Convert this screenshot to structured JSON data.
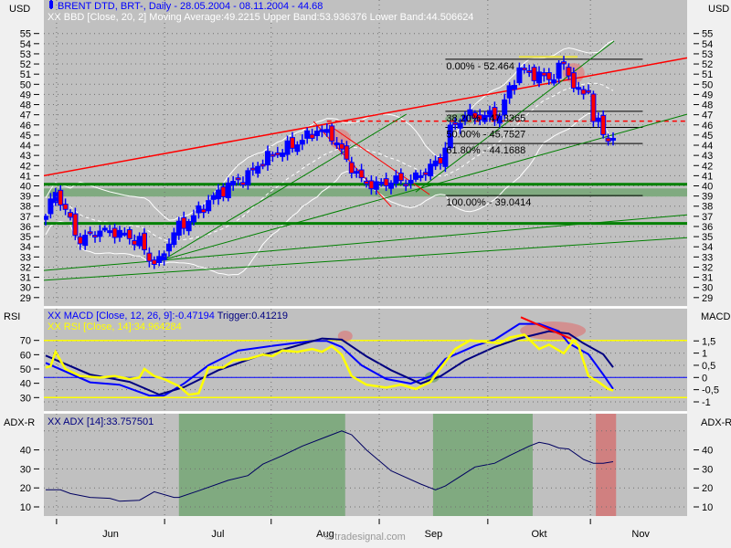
{
  "panels": {
    "main": {
      "axis_label_left": "USD",
      "axis_label_right": "USD",
      "title": "BRENT DTD, BRT-, Daily - 28.05.2004 - 08.11.2004 - 44.68",
      "bands_marker": "XX",
      "bands_legend": "BBD [Close, 20, 2] Moving Average:49.2215 Upper Band:53.936376 Lower Band:44.506624"
    },
    "rsi": {
      "axis_label_left": "RSI",
      "axis_label_right": "MACD",
      "macd_marker": "XX",
      "macd_legend": "MACD [Close, 12, 26, 9]:-0.47194",
      "trigger_legend": "Trigger:0.41219",
      "rsi_marker": "XX",
      "rsi_legend": "RSI [Close, 14]:34.964284"
    },
    "adx": {
      "axis_label_left": "ADX-R",
      "axis_label_right": "ADX-R",
      "marker": "XX",
      "legend": "ADX [14]:33.757501"
    }
  },
  "footer": "© tradesignal.com",
  "colors": {
    "plot_bg": "#c0c0c0",
    "page_bg": "#f0f0f0",
    "up_candle": "#0000ff",
    "down_candle": "#ff0000",
    "macd": "#0000ff",
    "trigger": "#000080",
    "rsi": "#ffff00",
    "adx": "#000060",
    "green_zone": "#80aa80",
    "red_zone": "#d08080",
    "support": "#008000",
    "trend_red": "#ff0000"
  },
  "chart_data": [
    {
      "type": "candlestick",
      "title": "BRENT DTD, BRT-, Daily - 28.05.2004 - 08.11.2004 - 44.68",
      "ylabel": "USD",
      "ylim": [
        29,
        55
      ],
      "yticks": [
        29,
        30,
        31,
        32,
        33,
        34,
        35,
        36,
        37,
        38,
        39,
        40,
        41,
        42,
        43,
        44,
        45,
        46,
        47,
        48,
        49,
        50,
        51,
        52,
        53,
        54,
        55
      ],
      "x_unit": "trading day since 28.05.2004",
      "x_range": [
        0,
        115
      ],
      "xticks": [
        {
          "label": "Jun",
          "day": 2.2
        },
        {
          "label": "Jul",
          "day": 24.1
        },
        {
          "label": "Aug",
          "day": 45.7
        },
        {
          "label": "Sep",
          "day": 67.6
        },
        {
          "label": "Okt",
          "day": 89.6
        },
        {
          "label": "Nov",
          "day": 110.4
        }
      ],
      "close_path": [
        [
          0,
          37.0
        ],
        [
          2,
          39.5
        ],
        [
          5,
          36.5
        ],
        [
          7,
          34.5
        ],
        [
          10,
          35.5
        ],
        [
          14,
          35.5
        ],
        [
          19,
          34.5
        ],
        [
          21,
          32.8
        ],
        [
          23,
          32.4
        ],
        [
          24,
          33.5
        ],
        [
          26,
          35.5
        ],
        [
          30,
          37.0
        ],
        [
          33,
          38.5
        ],
        [
          37,
          40.0
        ],
        [
          41,
          41.0
        ],
        [
          44,
          42.5
        ],
        [
          48,
          43.5
        ],
        [
          52,
          44.5
        ],
        [
          55,
          45.5
        ],
        [
          58,
          45.0
        ],
        [
          61,
          42.5
        ],
        [
          64,
          40.5
        ],
        [
          67,
          40.0
        ],
        [
          70,
          40.5
        ],
        [
          74,
          40.5
        ],
        [
          77,
          41.5
        ],
        [
          80,
          42.5
        ],
        [
          82,
          45.5
        ],
        [
          85,
          47.0
        ],
        [
          88,
          46.8
        ],
        [
          92,
          47.0
        ],
        [
          94,
          49.5
        ],
        [
          96,
          51.5
        ],
        [
          99,
          51.0
        ],
        [
          102,
          50.5
        ],
        [
          105,
          52.0
        ],
        [
          106,
          51.0
        ],
        [
          108,
          49.0
        ],
        [
          110,
          49.5
        ],
        [
          111,
          46.5
        ],
        [
          113,
          45.5
        ],
        [
          114,
          44.5
        ],
        [
          115,
          44.68
        ]
      ],
      "bollinger": {
        "period": 20,
        "stddev": 2,
        "moving_average": 49.2215,
        "upper": 53.936376,
        "lower": 44.506624
      },
      "fibonacci": {
        "from_day": 81,
        "to_day": 121,
        "levels": [
          {
            "label": "0.00% - 52.464",
            "price": 52.464
          },
          {
            "label": "38.20% - 47.3365",
            "price": 47.3365
          },
          {
            "label": "50.00% - 45.7527",
            "price": 45.7527
          },
          {
            "label": "61.80% - 44.1688",
            "price": 44.1688
          },
          {
            "label": "100.00% - 39.0414",
            "price": 39.0414
          }
        ]
      },
      "horizontal_lines": [
        {
          "price": 40.16,
          "color": "green",
          "style": "thick"
        },
        {
          "price": 36.3,
          "color": "green",
          "style": "thick"
        },
        {
          "price": 46.37,
          "from_day": 57,
          "color": "red",
          "style": "dashed"
        }
      ],
      "zone": {
        "from": 38.95,
        "to": 39.75,
        "color": "green"
      },
      "trend_lines": [
        {
          "color": "red",
          "points": [
            [
              -0.4,
              41.0
            ],
            [
              130,
              52.6
            ]
          ],
          "width": 1.5
        },
        {
          "color": "green",
          "points": [
            [
              -0.4,
              30.7
            ],
            [
              130,
              34.9
            ]
          ],
          "width": 1
        },
        {
          "color": "green",
          "points": [
            [
              -0.4,
              31.66
            ],
            [
              130,
              37.15
            ]
          ],
          "width": 1
        },
        {
          "color": "green",
          "points": [
            [
              22.2,
              32.5
            ],
            [
              130,
              47.05
            ]
          ],
          "width": 1
        },
        {
          "color": "green",
          "points": [
            [
              23.1,
              32.5
            ],
            [
              73.1,
              47.05
            ]
          ],
          "width": 1
        },
        {
          "color": "green",
          "points": [
            [
              75,
              39.4
            ],
            [
              115.2,
              54.25
            ]
          ],
          "width": 1
        },
        {
          "color": "red",
          "points": [
            [
              57.4,
              45.98
            ],
            [
              77.8,
              39.15
            ]
          ],
          "width": 1
        },
        {
          "color": "red",
          "points": [
            [
              54.3,
              46.34
            ],
            [
              70,
              37.96
            ]
          ],
          "width": 1
        },
        {
          "color": "yellow",
          "points": [
            [
              95.9,
              52.7
            ],
            [
              107.8,
              52.7
            ]
          ],
          "width": 2
        }
      ],
      "highlights": [
        {
          "color": "red",
          "day": 59.6,
          "price": 44.6
        },
        {
          "color": "red",
          "day": 107,
          "price": 51.1
        },
        {
          "color": "green",
          "day": 84.3,
          "price": 46.6
        }
      ]
    },
    {
      "type": "line",
      "title": "MACD / RSI",
      "rsi_ylim": [
        30,
        70
      ],
      "rsi_yticks": [
        30,
        40,
        50,
        60,
        70
      ],
      "macd_yticks": [
        {
          "v": 1.5,
          "label": "1,5"
        },
        {
          "v": 1,
          "label": "1"
        },
        {
          "v": 0.5,
          "label": "0,5"
        },
        {
          "v": 0,
          "label": "0"
        },
        {
          "v": -0.5,
          "label": "-0,5"
        },
        {
          "v": -1,
          "label": "-1"
        }
      ],
      "series": [
        {
          "name": "MACD [Close, 12, 26, 9]",
          "axis": "right",
          "points": [
            [
              0,
              0.6
            ],
            [
              9,
              -0.2
            ],
            [
              15,
              -0.3
            ],
            [
              21,
              -0.74
            ],
            [
              24,
              -0.74
            ],
            [
              28,
              -0.25
            ],
            [
              33,
              0.5
            ],
            [
              39,
              1.1
            ],
            [
              46,
              1.3
            ],
            [
              54,
              1.5
            ],
            [
              57,
              1.5
            ],
            [
              60,
              1.25
            ],
            [
              64,
              0.5
            ],
            [
              69,
              -0.06
            ],
            [
              74,
              -0.25
            ],
            [
              78,
              0.05
            ],
            [
              81,
              0.76
            ],
            [
              87,
              1.3
            ],
            [
              91,
              1.55
            ],
            [
              96,
              2.2
            ],
            [
              100,
              2.2
            ],
            [
              104,
              1.9
            ],
            [
              106,
              1.4
            ],
            [
              110,
              0.95
            ],
            [
              113,
              0.12
            ],
            [
              115,
              -0.47
            ]
          ]
        },
        {
          "name": "Trigger",
          "axis": "right",
          "points": [
            [
              0,
              0.9
            ],
            [
              9,
              0.12
            ],
            [
              17,
              -0.18
            ],
            [
              23,
              -0.7
            ],
            [
              28,
              -0.4
            ],
            [
              35,
              0.3
            ],
            [
              43,
              0.87
            ],
            [
              50,
              1.25
            ],
            [
              56,
              1.6
            ],
            [
              60,
              1.55
            ],
            [
              65,
              0.87
            ],
            [
              70,
              0.3
            ],
            [
              76,
              -0.25
            ],
            [
              80,
              0.05
            ],
            [
              85,
              0.7
            ],
            [
              91,
              1.25
            ],
            [
              96,
              1.6
            ],
            [
              102,
              1.9
            ],
            [
              106,
              1.8
            ],
            [
              109,
              1.4
            ],
            [
              113,
              0.95
            ],
            [
              115,
              0.42
            ]
          ]
        },
        {
          "name": "RSI [Close, 14]",
          "axis": "left",
          "points": [
            [
              0,
              51
            ],
            [
              1,
              52
            ],
            [
              2,
              62
            ],
            [
              4,
              50
            ],
            [
              7,
              45
            ],
            [
              11,
              44
            ],
            [
              14,
              45
            ],
            [
              17,
              43
            ],
            [
              19,
              44
            ],
            [
              20,
              50
            ],
            [
              22,
              45
            ],
            [
              24,
              43
            ],
            [
              27,
              38
            ],
            [
              29,
              32
            ],
            [
              31,
              33
            ],
            [
              33,
              51
            ],
            [
              36,
              51
            ],
            [
              38,
              56
            ],
            [
              41,
              57
            ],
            [
              44,
              60
            ],
            [
              46,
              59
            ],
            [
              48,
              63
            ],
            [
              51,
              62
            ],
            [
              54,
              64
            ],
            [
              56,
              62
            ],
            [
              58,
              66
            ],
            [
              60,
              60
            ],
            [
              62,
              45
            ],
            [
              65,
              39
            ],
            [
              69,
              37
            ],
            [
              72,
              39
            ],
            [
              75,
              36
            ],
            [
              78,
              41
            ],
            [
              81,
              55
            ],
            [
              83,
              64
            ],
            [
              86,
              70
            ],
            [
              89,
              69
            ],
            [
              92,
              68
            ],
            [
              94,
              72
            ],
            [
              97,
              74
            ],
            [
              100,
              64
            ],
            [
              102,
              67
            ],
            [
              105,
              61
            ],
            [
              107,
              70
            ],
            [
              108,
              66
            ],
            [
              110,
              45
            ],
            [
              112,
              41
            ],
            [
              114,
              36
            ],
            [
              115,
              35
            ]
          ]
        }
      ],
      "reference_lines": {
        "rsi": [
          70,
          30
        ],
        "macd": [
          0
        ]
      },
      "highlights": [
        {
          "color": "red",
          "day": 102.8,
          "rsi": 76.8
        },
        {
          "color": "green",
          "day": 78.3,
          "rsi": 44.3
        },
        {
          "color": "red",
          "day": 60.7,
          "rsi": 73
        }
      ],
      "trend_line": {
        "color": "red",
        "points": [
          [
            96.3,
            86.2
          ],
          [
            106.5,
            71.1
          ]
        ]
      }
    },
    {
      "type": "line",
      "title": "ADX [14]",
      "ylim": [
        5,
        56
      ],
      "yticks": [
        10,
        20,
        30,
        40
      ],
      "series": [
        {
          "name": "ADX [14]",
          "points": [
            [
              0,
              19
            ],
            [
              3,
              19
            ],
            [
              5,
              17
            ],
            [
              9,
              15
            ],
            [
              13,
              14.5
            ],
            [
              15,
              13
            ],
            [
              19,
              13.5
            ],
            [
              22,
              18
            ],
            [
              26,
              15
            ],
            [
              27,
              15
            ],
            [
              31,
              18.5
            ],
            [
              37,
              24
            ],
            [
              41,
              26.5
            ],
            [
              44,
              32.5
            ],
            [
              48,
              37
            ],
            [
              52,
              42
            ],
            [
              57,
              47
            ],
            [
              60,
              50
            ],
            [
              62,
              48
            ],
            [
              65,
              40
            ],
            [
              70,
              29
            ],
            [
              76,
              22
            ],
            [
              79,
              19
            ],
            [
              81,
              21
            ],
            [
              87,
              31
            ],
            [
              91,
              33
            ],
            [
              94,
              37
            ],
            [
              98,
              42
            ],
            [
              100,
              44
            ],
            [
              102,
              43
            ],
            [
              104,
              41
            ],
            [
              106,
              40.5
            ],
            [
              109,
              35
            ],
            [
              111,
              33
            ],
            [
              113,
              33
            ],
            [
              115,
              33.8
            ]
          ]
        }
      ],
      "zones": [
        {
          "color": "green",
          "from_day": 27,
          "to_day": 60.7
        },
        {
          "color": "green",
          "from_day": 78.5,
          "to_day": 98.7
        },
        {
          "color": "red",
          "from_day": 111.5,
          "to_day": 115.6
        }
      ]
    }
  ]
}
